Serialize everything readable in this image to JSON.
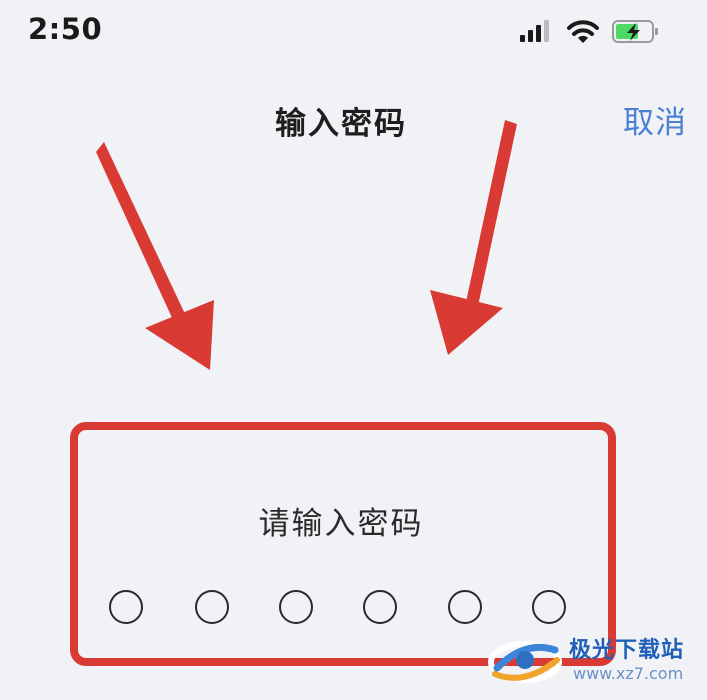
{
  "status_bar": {
    "time": "2:50",
    "signal_icon": "cellular-signal-icon",
    "wifi_icon": "wifi-icon",
    "battery_icon": "battery-charging-icon",
    "battery_color": "#4cd964"
  },
  "nav": {
    "title": "输入密码",
    "cancel_label": "取消",
    "cancel_color": "#4c7fd6"
  },
  "password": {
    "label": "请输入密码",
    "length": 6,
    "entered": 0
  },
  "annotation": {
    "color": "#d93a33",
    "arrows": 2
  },
  "watermark": {
    "name": "极光下载站",
    "url": "www.xz7.com"
  }
}
